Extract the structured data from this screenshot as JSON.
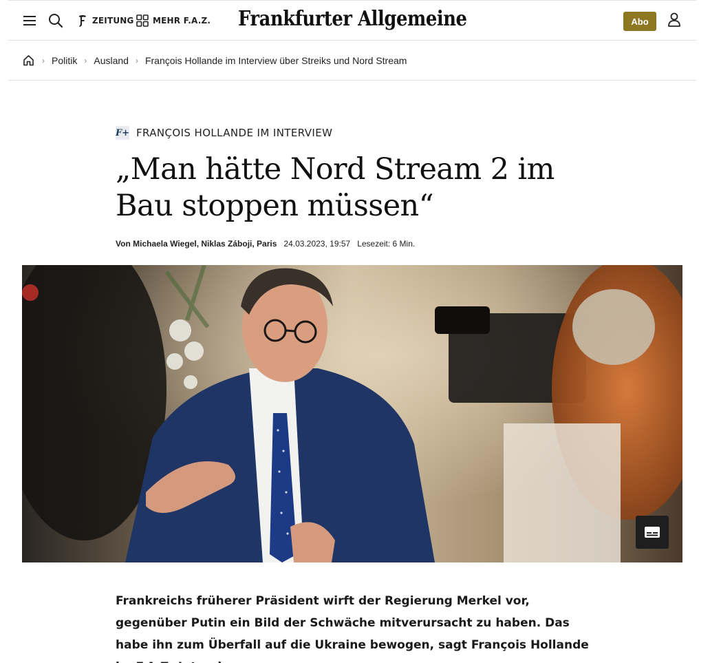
{
  "header": {
    "zeitung_label": "ZEITUNG",
    "mehr_label": "MEHR F.A.Z.",
    "logo_text": "Frankfurter Allgemeine",
    "abo_label": "Abo",
    "accent_color": "#8e7721"
  },
  "breadcrumb": {
    "items": [
      "Politik",
      "Ausland"
    ],
    "current": "François Hollande im Interview über Streiks und Nord Stream"
  },
  "article": {
    "badge": "F+",
    "kicker": "FRANÇOIS HOLLANDE IM INTERVIEW",
    "headline": "„Man hätte Nord Stream 2 im Bau stoppen müssen“",
    "author": "Von Michaela Wiegel, Niklas Záboji, Paris",
    "date": "24.03.2023, 19:57",
    "reading_time": "Lesezeit: 6 Min.",
    "lead": "Frankreichs früherer Präsident wirft der Regierung Merkel vor, gegenüber Putin ein Bild der Schwäche mitverursacht zu haben. Das habe ihn zum Überfall auf die Ukraine bewogen, sagt François Hollande im F.A.Z.-Interview."
  },
  "icons": {
    "menu": "menu-icon",
    "search": "search-icon",
    "zeitung": "faz-f-icon",
    "mehr": "grid-icon",
    "user": "user-icon",
    "home": "home-icon",
    "captions": "captions-icon"
  }
}
